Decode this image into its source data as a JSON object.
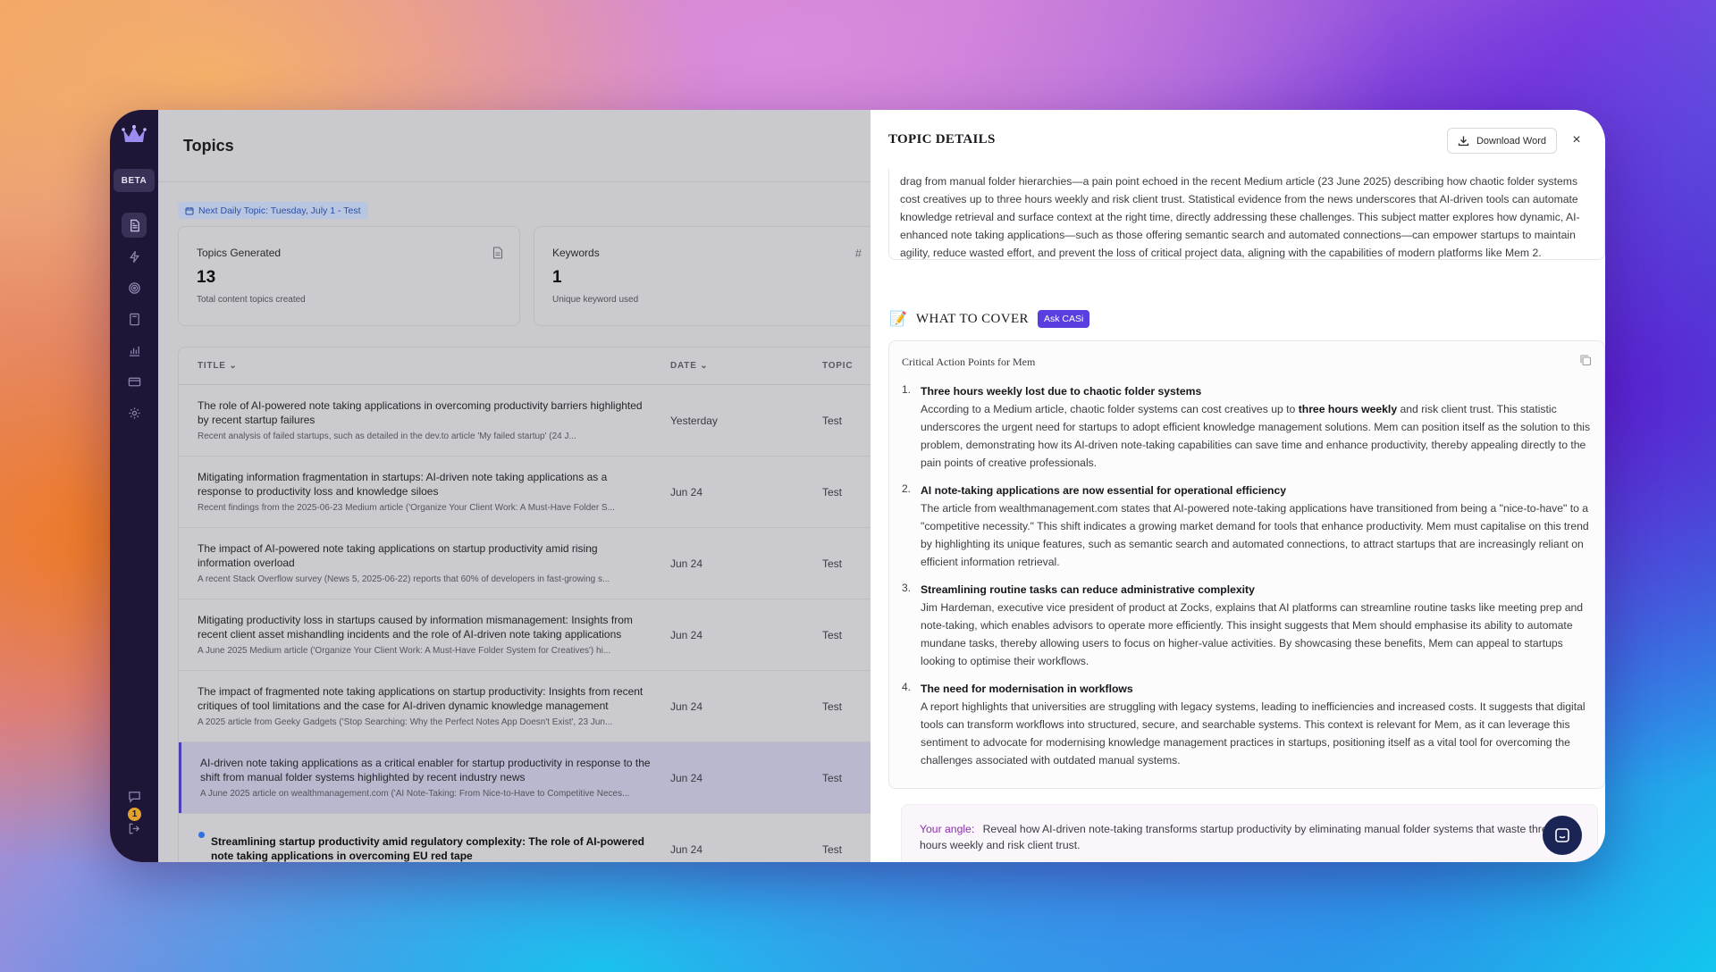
{
  "sidebar": {
    "beta_label": "BETA",
    "notification_count": "1",
    "icons": [
      "document-icon",
      "lightning-icon",
      "target-icon",
      "book-icon",
      "bar-chart-icon",
      "credit-card-icon",
      "gear-icon"
    ]
  },
  "header": {
    "title": "Topics"
  },
  "next_topic": {
    "label": "Next Daily Topic: Tuesday, July 1 - Test"
  },
  "stats": {
    "topics": {
      "label": "Topics Generated",
      "value": "13",
      "sub": "Total content topics created"
    },
    "keywords": {
      "label": "Keywords",
      "value": "1",
      "sub": "Unique keyword used"
    }
  },
  "table": {
    "headers": {
      "title": "TITLE",
      "date": "DATE",
      "topic": "TOPIC"
    },
    "rows": [
      {
        "title": "The role of AI-powered note taking applications in overcoming productivity barriers highlighted by recent startup failures",
        "desc": "Recent analysis of failed startups, such as detailed in the dev.to article 'My failed startup' (24 J...",
        "date": "Yesterday",
        "topic": "Test"
      },
      {
        "title": "Mitigating information fragmentation in startups: AI-driven note taking applications as a response to productivity loss and knowledge siloes",
        "desc": "Recent findings from the 2025-06-23 Medium article ('Organize Your Client Work: A Must-Have Folder S...",
        "date": "Jun 24",
        "topic": "Test"
      },
      {
        "title": "The impact of AI-powered note taking applications on startup productivity amid rising information overload",
        "desc": "A recent Stack Overflow survey (News 5, 2025-06-22) reports that 60% of developers in fast-growing s...",
        "date": "Jun 24",
        "topic": "Test"
      },
      {
        "title": "Mitigating productivity loss in startups caused by information mismanagement: Insights from recent client asset mishandling incidents and the role of AI-driven note taking applications",
        "desc": "A June 2025 Medium article ('Organize Your Client Work: A Must-Have Folder System for Creatives') hi...",
        "date": "Jun 24",
        "topic": "Test"
      },
      {
        "title": "The impact of fragmented note taking applications on startup productivity: Insights from recent critiques of tool limitations and the case for AI-driven dynamic knowledge management",
        "desc": "A 2025 article from Geeky Gadgets ('Stop Searching: Why the Perfect Notes App Doesn't Exist', 23 Jun...",
        "date": "Jun 24",
        "topic": "Test"
      },
      {
        "title": "AI-driven note taking applications as a critical enabler for startup productivity in response to the shift from manual folder systems highlighted by recent industry news",
        "desc": "A June 2025 article on wealthmanagement.com ('AI Note-Taking: From Nice-to-Have to Competitive Neces...",
        "date": "Jun 24",
        "topic": "Test"
      },
      {
        "title": "Streamlining startup productivity amid regulatory complexity: The role of AI-powered note taking applications in overcoming EU red tape",
        "desc": "",
        "date": "Jun 24",
        "topic": "Test"
      }
    ]
  },
  "details": {
    "title": "TOPIC DETAILS",
    "download_label": "Download Word",
    "body": "drag from manual folder hierarchies—a pain point echoed in the recent Medium article (23 June 2025) describing how chaotic folder systems cost creatives up to three hours weekly and risk client trust. Statistical evidence from the news underscores that AI-driven tools can automate knowledge retrieval and surface context at the right time, directly addressing these challenges. This subject matter explores how dynamic, AI-enhanced note taking applications—such as those offering semantic search and automated connections—can empower startups to maintain agility, reduce wasted effort, and prevent the loss of critical project data, aligning with the capabilities of modern platforms like Mem 2.",
    "cover_emoji": "📝",
    "cover_title": "WHAT TO COVER",
    "ask_label": "Ask CASi",
    "cover_subtitle": "Critical Action Points for Mem",
    "points": [
      {
        "num": "1.",
        "title": "Three hours weekly lost due to chaotic folder systems",
        "text_a": "According to a Medium article, chaotic folder systems can cost creatives up to ",
        "bold": "three hours weekly",
        "text_b": " and risk client trust. This statistic underscores the urgent need for startups to adopt efficient knowledge management solutions. Mem can position itself as the solution to this problem, demonstrating how its AI-driven note-taking capabilities can save time and enhance productivity, thereby appealing directly to the pain points of creative professionals."
      },
      {
        "num": "2.",
        "title": "AI note-taking applications are now essential for operational efficiency",
        "text_a": "The article from wealthmanagement.com states that AI-powered note-taking applications have transitioned from being a \"nice-to-have\" to a \"competitive necessity.\" This shift indicates a growing market demand for tools that enhance productivity. Mem must capitalise on this trend by highlighting its unique features, such as semantic search and automated connections, to attract startups that are increasingly reliant on efficient information retrieval.",
        "bold": "",
        "text_b": ""
      },
      {
        "num": "3.",
        "title": "Streamlining routine tasks can reduce administrative complexity",
        "text_a": "Jim Hardeman, executive vice president of product at Zocks, explains that AI platforms can streamline routine tasks like meeting prep and note-taking, which enables advisors to operate more efficiently. This insight suggests that Mem should emphasise its ability to automate mundane tasks, thereby allowing users to focus on higher-value activities. By showcasing these benefits, Mem can appeal to startups looking to optimise their workflows.",
        "bold": "",
        "text_b": ""
      },
      {
        "num": "4.",
        "title": "The need for modernisation in workflows",
        "text_a": "A report highlights that universities are struggling with legacy systems, leading to inefficiencies and increased costs. It suggests that digital tools can transform workflows into structured, secure, and searchable systems. This context is relevant for Mem, as it can leverage this sentiment to advocate for modernising knowledge management practices in startups, positioning itself as a vital tool for overcoming the challenges associated with outdated manual systems.",
        "bold": "",
        "text_b": ""
      }
    ],
    "angle_label": "Your angle:",
    "angle_text": "Reveal how AI-driven note-taking transforms startup productivity by eliminating manual folder systems that waste three hours weekly and risk client trust."
  },
  "colors": {
    "accent": "#5a3ee0",
    "sidebar_bg": "#1f1537",
    "link": "#2f6fe0"
  }
}
